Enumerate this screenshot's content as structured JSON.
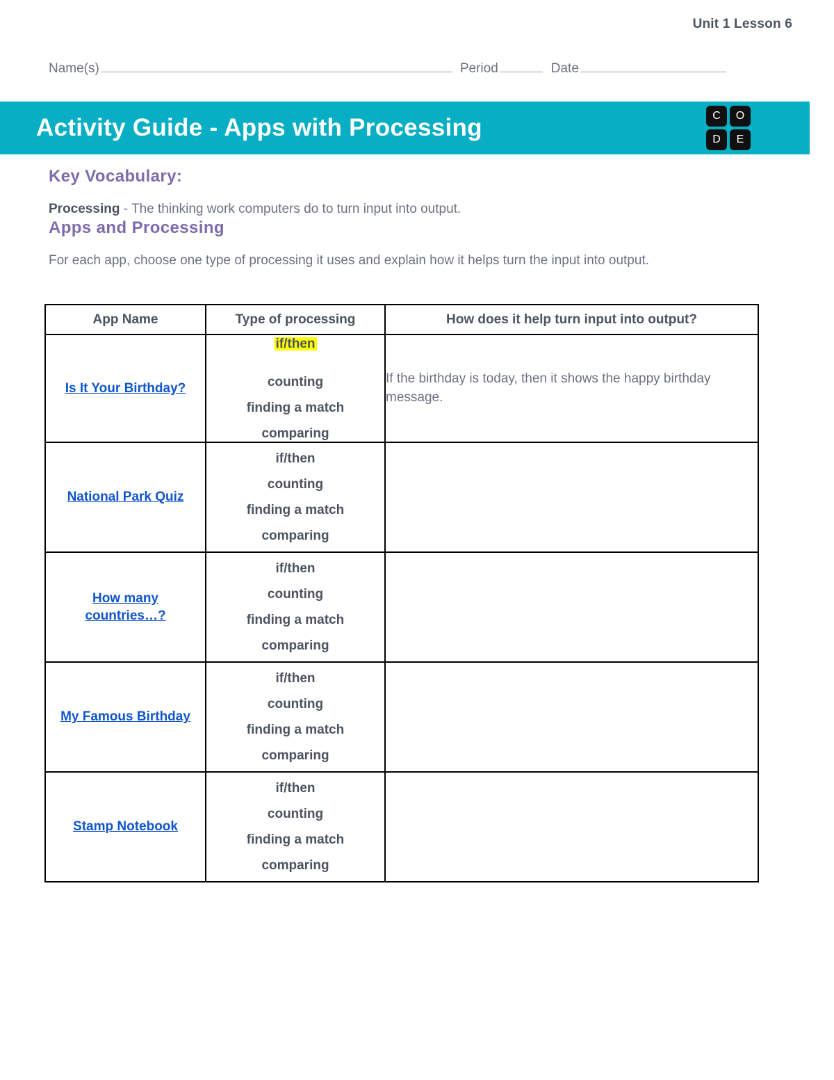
{
  "header": {
    "unit_lesson": "Unit 1 Lesson 6",
    "name_label": "Name(s)",
    "period_label": "Period",
    "date_label": "Date"
  },
  "banner": {
    "title": "Activity Guide - Apps with Processing",
    "color": "#07aec4",
    "logo_letters": [
      "C",
      "O",
      "D",
      "E"
    ]
  },
  "vocabulary": {
    "heading": "Key Vocabulary:",
    "term": "Processing",
    "definition": " - The thinking work computers do to turn input into output."
  },
  "apps_section": {
    "heading": "Apps and Processing",
    "instructions": "For each app, choose one type of processing it uses and explain how it helps turn the input into output."
  },
  "table": {
    "columns": [
      "App Name",
      "Type of processing",
      "How does it help turn input into output?"
    ],
    "processing_options": [
      "if/then",
      "counting",
      "finding a match",
      "comparing"
    ],
    "highlight_color": "#ffff00",
    "link_color": "#1155cc",
    "rows": [
      {
        "app_name": "Is It Your Birthday?",
        "app_name_line2": "",
        "selected_option": "if/then",
        "answer": "If the birthday is today, then it shows the happy birthday message."
      },
      {
        "app_name": "National Park Quiz",
        "app_name_line2": "",
        "selected_option": "",
        "answer": ""
      },
      {
        "app_name": "How many",
        "app_name_line2": "countries…?",
        "selected_option": "",
        "answer": ""
      },
      {
        "app_name": "My Famous Birthday",
        "app_name_line2": "",
        "selected_option": "",
        "answer": ""
      },
      {
        "app_name": "Stamp Notebook",
        "app_name_line2": "",
        "selected_option": "",
        "answer": ""
      }
    ]
  }
}
